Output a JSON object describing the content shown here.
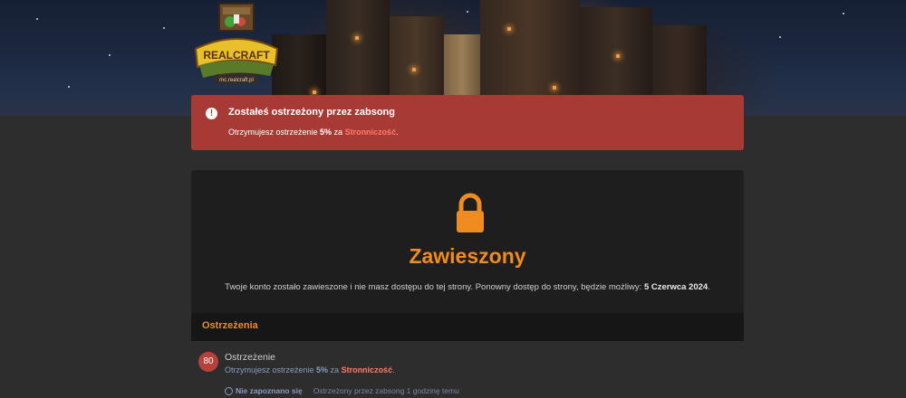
{
  "banner": {
    "logo_text": "REALCRAFT",
    "logo_subtext": "mc.realcraft.pl"
  },
  "alert": {
    "icon": "exclamation-circle-icon",
    "title": "Zostałeś ostrzeżony przez zabsong",
    "text_prefix": "Otrzymujesz ostrzeżenie ",
    "percent": "5%",
    "text_mid": " za ",
    "reason": "Stronniczość",
    "text_suffix": "."
  },
  "suspension": {
    "icon": "lock-icon",
    "title": "Zawieszony",
    "text": "Twoje konto zostało zawieszone i nie masz dostępu do tej strony. Ponowny dostęp do strony, będzie możliwy:",
    "date": "5 Czerwca 2024",
    "date_suffix": "."
  },
  "warnings": {
    "header": "Ostrzeżenia",
    "items": [
      {
        "badge": "80",
        "title": "Ostrzeżenie",
        "desc_prefix": "Otrzymujesz ostrzeżenie ",
        "percent": "5%",
        "desc_mid": " za ",
        "reason": "Stronniczość",
        "desc_suffix": ".",
        "status_label": "Nie zapoznano się",
        "meta": "Ostrzeżony przez zabsong 1 godzinę temu"
      }
    ]
  },
  "colors": {
    "accent": "#f08c1f",
    "alert_bg": "#a83a35",
    "reason": "#ff7b6b",
    "badge": "#b8413b"
  }
}
